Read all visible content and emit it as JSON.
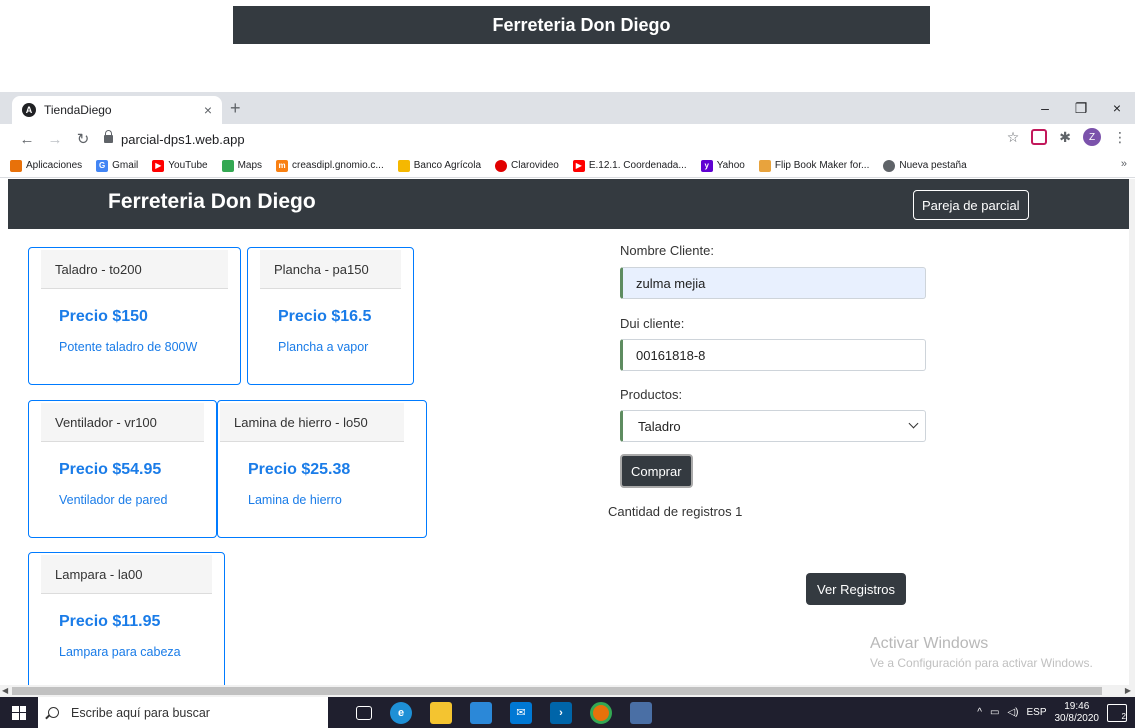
{
  "banner": {
    "title": "Ferreteria Don Diego"
  },
  "browser": {
    "tab_title": "TiendaDiego",
    "tab_favicon": "A",
    "tab_close": "×",
    "new_tab": "+",
    "minimize": "–",
    "restore": "❐",
    "close": "×",
    "url": "parcial-dps1.web.app",
    "profile_initial": "Z",
    "bookmarks": [
      {
        "label": "Aplicaciones",
        "icon": "apps-grid-icon",
        "color": "#e8710a"
      },
      {
        "label": "Gmail",
        "icon": "google-icon",
        "color": "#4285f4"
      },
      {
        "label": "YouTube",
        "icon": "youtube-icon",
        "color": "#ff0000"
      },
      {
        "label": "Maps",
        "icon": "maps-pin-icon",
        "color": "#34a853"
      },
      {
        "label": "creasdipl.gnomio.c...",
        "icon": "moodle-icon",
        "color": "#f98012"
      },
      {
        "label": "Banco Agrícola",
        "icon": "bank-icon",
        "color": "#f5b800"
      },
      {
        "label": "Clarovideo",
        "icon": "claro-icon",
        "color": "#e10000"
      },
      {
        "label": "E.12.1. Coordenada...",
        "icon": "youtube-icon",
        "color": "#ff0000"
      },
      {
        "label": "Yahoo",
        "icon": "yahoo-icon",
        "color": "#6001d2"
      },
      {
        "label": "Flip Book Maker for...",
        "icon": "flipbook-icon",
        "color": "#e8a33d"
      },
      {
        "label": "Nueva pestaña",
        "icon": "chrome-icon",
        "color": "#5f6368"
      }
    ],
    "bookmarks_more": "»"
  },
  "navbar": {
    "brand": "Ferreteria Don Diego",
    "pareja_label": "Pareja de parcial"
  },
  "products": [
    {
      "header": "Taladro - to200",
      "price": "Precio $150",
      "desc": "Potente taladro de 800W"
    },
    {
      "header": "Plancha - pa150",
      "price": "Precio $16.5",
      "desc": "Plancha a vapor"
    },
    {
      "header": "Ventilador - vr100",
      "price": "Precio $54.95",
      "desc": "Ventilador de pared"
    },
    {
      "header": "Lamina de hierro - lo50",
      "price": "Precio $25.38",
      "desc": "Lamina de hierro"
    },
    {
      "header": "Lampara - la00",
      "price": "Precio $11.95",
      "desc": "Lampara para cabeza"
    }
  ],
  "form": {
    "nombre_label": "Nombre Cliente:",
    "nombre_value": "zulma mejia",
    "dui_label": "Dui cliente:",
    "dui_value": "00161818-8",
    "productos_label": "Productos:",
    "productos_selected": "Taladro",
    "comprar_label": "Comprar",
    "cantidad_text": "Cantidad de registros 1",
    "ver_registros_label": "Ver Registros"
  },
  "watermark": {
    "line1": "Activar Windows",
    "line2": "Ve a Configuración para activar Windows."
  },
  "taskbar": {
    "search_placeholder": "Escribe aquí para buscar",
    "lang": "ESP",
    "time": "19:46",
    "date": "30/8/2020",
    "notif_count": "2"
  },
  "colors": {
    "navbar_bg": "#343a40",
    "card_border": "#007bff",
    "price_text": "#1a7ce8",
    "input_accent": "#5e8c60",
    "autofill_bg": "#e8f0fe"
  }
}
